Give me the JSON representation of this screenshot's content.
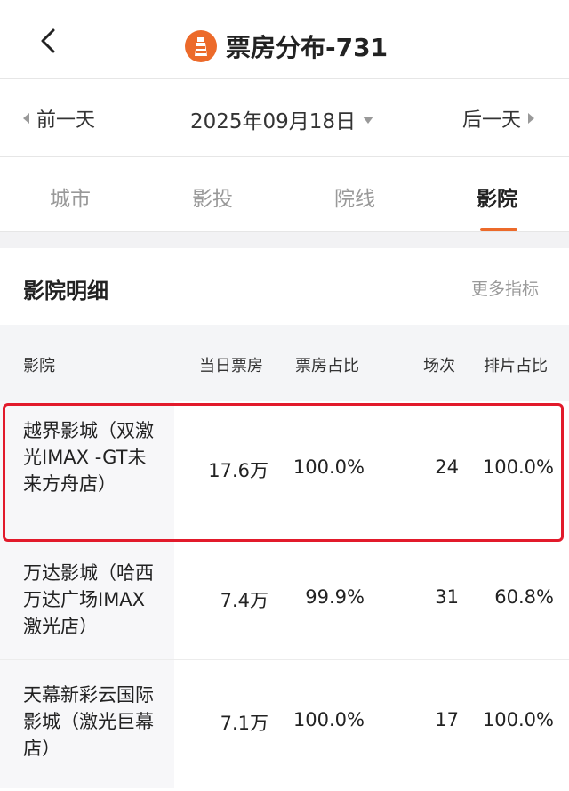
{
  "header": {
    "title": "票房分布-731",
    "back_icon": "chevron-left-icon",
    "logo_icon": "lighthouse-logo-icon"
  },
  "datebar": {
    "prev_label": "前一天",
    "date": "2025年09月18日",
    "next_label": "后一天"
  },
  "tabs": [
    {
      "label": "城市",
      "active": false
    },
    {
      "label": "影投",
      "active": false
    },
    {
      "label": "院线",
      "active": false
    },
    {
      "label": "影院",
      "active": true
    }
  ],
  "section": {
    "title": "影院明细",
    "more_label": "更多指标"
  },
  "table": {
    "columns": [
      "影院",
      "当日票房",
      "票房占比",
      "场次",
      "排片占比"
    ],
    "rows": [
      {
        "name": "越界影城（双激光IMAX -GT未来方舟店）",
        "box_office": "17.6万",
        "share": "100.0%",
        "shows": "24",
        "schedule_share": "100.0%",
        "highlighted": true
      },
      {
        "name": "万达影城（哈西万达广场IMAX激光店）",
        "box_office": "7.4万",
        "share": "99.9%",
        "shows": "31",
        "schedule_share": "60.8%",
        "highlighted": false
      },
      {
        "name": "天幕新彩云国际影城（激光巨幕店）",
        "box_office": "7.1万",
        "share": "100.0%",
        "shows": "17",
        "schedule_share": "100.0%",
        "highlighted": false
      }
    ]
  },
  "colors": {
    "accent": "#ec6a2a",
    "highlight_border": "#e21a2b"
  }
}
